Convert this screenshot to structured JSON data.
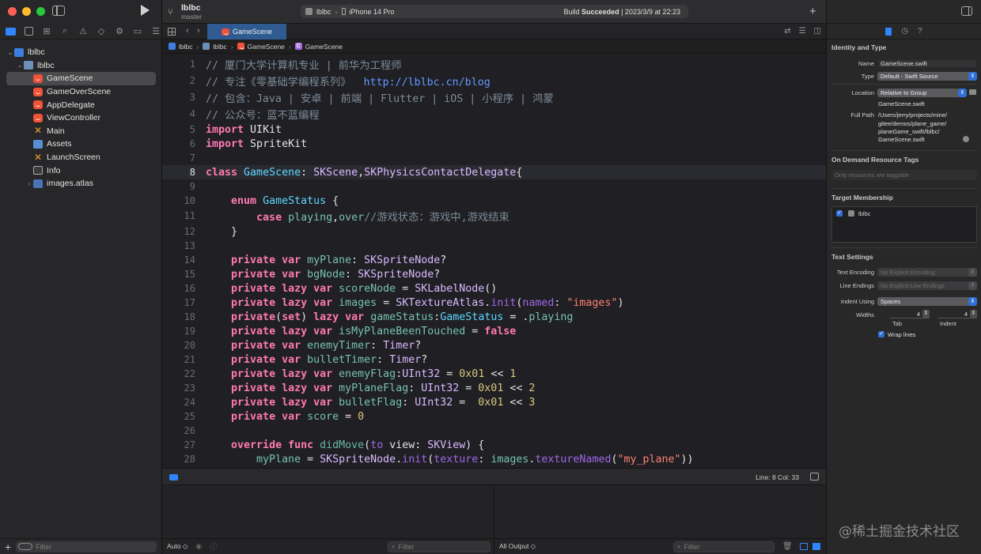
{
  "toolbar": {
    "project": "lblbc",
    "branch": "master",
    "scheme": "lblbc",
    "device": "iPhone 14 Pro",
    "build_prefix": "Build",
    "build_status": "Succeeded",
    "build_time": "| 2023/3/9 at 22:23",
    "add": "+"
  },
  "colors": {
    "accent": "#2f86ff",
    "close": "#ff5f57",
    "minimize": "#febc2e",
    "zoom": "#28c840",
    "keyword": "#ff7ab2",
    "comment": "#7f8c98",
    "string": "#ff8170",
    "number": "#d9c97c"
  },
  "navigator": {
    "tabs": [
      "folder-icon",
      "source-control-icon",
      "symbol-icon",
      "search-icon",
      "warning-icon",
      "test-icon",
      "debug-icon",
      "breakpoint-icon",
      "report-icon"
    ],
    "tree": [
      {
        "label": "lblbc",
        "icon": "project-icon",
        "indent": 0,
        "disclosure": "⌄"
      },
      {
        "label": "lblbc",
        "icon": "folder-icon",
        "indent": 1,
        "disclosure": "⌄"
      },
      {
        "label": "GameScene",
        "icon": "swift-icon",
        "indent": 2,
        "selected": true
      },
      {
        "label": "GameOverScene",
        "icon": "swift-icon",
        "indent": 2
      },
      {
        "label": "AppDelegate",
        "icon": "swift-icon",
        "indent": 2
      },
      {
        "label": "ViewController",
        "icon": "swift-icon",
        "indent": 2
      },
      {
        "label": "Main",
        "icon": "storyboard-icon",
        "indent": 2
      },
      {
        "label": "Assets",
        "icon": "assets-icon",
        "indent": 2
      },
      {
        "label": "LaunchScreen",
        "icon": "storyboard-icon",
        "indent": 2
      },
      {
        "label": "Info",
        "icon": "plist-icon",
        "indent": 2
      },
      {
        "label": "images.atlas",
        "icon": "atlas-icon",
        "indent": 2,
        "disclosure": "›"
      }
    ],
    "filter_placeholder": "Filter"
  },
  "tabbar": {
    "active_tab": "GameScene"
  },
  "breadcrumb": [
    "lblbc",
    "lblbc",
    "GameScene",
    "GameScene"
  ],
  "editor": {
    "current_line": 8,
    "lines": [
      {
        "n": "1",
        "tokens": [
          [
            "cmt",
            "// 厦门大学计算机专业 | 前华为工程师"
          ]
        ]
      },
      {
        "n": "2",
        "tokens": [
          [
            "cmt",
            "// 专注《零基础学编程系列》  "
          ],
          [
            "url",
            "http://lblbc.cn/blog"
          ]
        ]
      },
      {
        "n": "3",
        "tokens": [
          [
            "cmt",
            "// 包含：Java | 安卓 | 前端 | Flutter | iOS | 小程序 | 鸿蒙"
          ]
        ]
      },
      {
        "n": "4",
        "tokens": [
          [
            "cmt",
            "// 公众号：蓝不蓝编程"
          ]
        ]
      },
      {
        "n": "5",
        "tokens": [
          [
            "kw",
            "import"
          ],
          [
            "pl",
            " UIKit"
          ]
        ]
      },
      {
        "n": "6",
        "tokens": [
          [
            "kw",
            "import"
          ],
          [
            "pl",
            " SpriteKit"
          ]
        ]
      },
      {
        "n": "7",
        "tokens": []
      },
      {
        "n": "8",
        "tokens": [
          [
            "kw",
            "class"
          ],
          [
            "pl",
            " "
          ],
          [
            "tyd",
            "GameScene"
          ],
          [
            "pl",
            ": "
          ],
          [
            "ty",
            "SKScene"
          ],
          [
            "pl",
            ","
          ],
          [
            "ty",
            "SKPhysicsContactDelegate"
          ],
          [
            "pl",
            "{"
          ]
        ]
      },
      {
        "n": "9",
        "tokens": []
      },
      {
        "n": "10",
        "tokens": [
          [
            "pl",
            "    "
          ],
          [
            "kw",
            "enum"
          ],
          [
            "pl",
            " "
          ],
          [
            "tyd",
            "GameStatus"
          ],
          [
            "pl",
            " {"
          ]
        ]
      },
      {
        "n": "11",
        "tokens": [
          [
            "pl",
            "        "
          ],
          [
            "kw",
            "case"
          ],
          [
            "pl",
            " "
          ],
          [
            "idf",
            "playing"
          ],
          [
            "pl",
            ","
          ],
          [
            "idf",
            "over"
          ],
          [
            "cmt",
            "//游戏状态：游戏中,游戏结束"
          ]
        ]
      },
      {
        "n": "12",
        "tokens": [
          [
            "pl",
            "    }"
          ]
        ]
      },
      {
        "n": "13",
        "tokens": []
      },
      {
        "n": "14",
        "tokens": [
          [
            "pl",
            "    "
          ],
          [
            "kw",
            "private var"
          ],
          [
            "pl",
            " "
          ],
          [
            "idf",
            "myPlane"
          ],
          [
            "pl",
            ": "
          ],
          [
            "ty",
            "SKSpriteNode"
          ],
          [
            "pl",
            "?"
          ]
        ]
      },
      {
        "n": "15",
        "tokens": [
          [
            "pl",
            "    "
          ],
          [
            "kw",
            "private var"
          ],
          [
            "pl",
            " "
          ],
          [
            "idf",
            "bgNode"
          ],
          [
            "pl",
            ": "
          ],
          [
            "ty",
            "SKSpriteNode"
          ],
          [
            "pl",
            "?"
          ]
        ]
      },
      {
        "n": "16",
        "tokens": [
          [
            "pl",
            "    "
          ],
          [
            "kw",
            "private lazy var"
          ],
          [
            "pl",
            " "
          ],
          [
            "idf",
            "scoreNode"
          ],
          [
            "pl",
            " = "
          ],
          [
            "ty",
            "SKLabelNode"
          ],
          [
            "pl",
            "()"
          ]
        ]
      },
      {
        "n": "17",
        "tokens": [
          [
            "pl",
            "    "
          ],
          [
            "kw",
            "private lazy var"
          ],
          [
            "pl",
            " "
          ],
          [
            "idf",
            "images"
          ],
          [
            "pl",
            " = "
          ],
          [
            "ty",
            "SKTextureAtlas"
          ],
          [
            "pl",
            "."
          ],
          [
            "var",
            "init"
          ],
          [
            "pl",
            "("
          ],
          [
            "var",
            "named"
          ],
          [
            "pl",
            ": "
          ],
          [
            "str",
            "\"images\""
          ],
          [
            "pl",
            ")"
          ]
        ]
      },
      {
        "n": "18",
        "tokens": [
          [
            "pl",
            "    "
          ],
          [
            "kw",
            "private"
          ],
          [
            "pl",
            "("
          ],
          [
            "kw",
            "set"
          ],
          [
            "pl",
            ") "
          ],
          [
            "kw",
            "lazy var"
          ],
          [
            "pl",
            " "
          ],
          [
            "idf",
            "gameStatus"
          ],
          [
            "pl",
            ":"
          ],
          [
            "tyd",
            "GameStatus"
          ],
          [
            "pl",
            " = ."
          ],
          [
            "idf",
            "playing"
          ]
        ]
      },
      {
        "n": "19",
        "tokens": [
          [
            "pl",
            "    "
          ],
          [
            "kw",
            "private lazy var"
          ],
          [
            "pl",
            " "
          ],
          [
            "idf",
            "isMyPlaneBeenTouched"
          ],
          [
            "pl",
            " = "
          ],
          [
            "kw",
            "false"
          ]
        ]
      },
      {
        "n": "20",
        "tokens": [
          [
            "pl",
            "    "
          ],
          [
            "kw",
            "private var"
          ],
          [
            "pl",
            " "
          ],
          [
            "idf",
            "enemyTimer"
          ],
          [
            "pl",
            ": "
          ],
          [
            "ty",
            "Timer"
          ],
          [
            "pl",
            "?"
          ]
        ]
      },
      {
        "n": "21",
        "tokens": [
          [
            "pl",
            "    "
          ],
          [
            "kw",
            "private var"
          ],
          [
            "pl",
            " "
          ],
          [
            "idf",
            "bulletTimer"
          ],
          [
            "pl",
            ": "
          ],
          [
            "ty",
            "Timer"
          ],
          [
            "pl",
            "?"
          ]
        ]
      },
      {
        "n": "22",
        "tokens": [
          [
            "pl",
            "    "
          ],
          [
            "kw",
            "private lazy var"
          ],
          [
            "pl",
            " "
          ],
          [
            "idf",
            "enemyFlag"
          ],
          [
            "pl",
            ":"
          ],
          [
            "ty",
            "UInt32"
          ],
          [
            "pl",
            " = "
          ],
          [
            "num",
            "0x01"
          ],
          [
            "pl",
            " << "
          ],
          [
            "num",
            "1"
          ]
        ]
      },
      {
        "n": "23",
        "tokens": [
          [
            "pl",
            "    "
          ],
          [
            "kw",
            "private lazy var"
          ],
          [
            "pl",
            " "
          ],
          [
            "idf",
            "myPlaneFlag"
          ],
          [
            "pl",
            ": "
          ],
          [
            "ty",
            "UInt32"
          ],
          [
            "pl",
            " = "
          ],
          [
            "num",
            "0x01"
          ],
          [
            "pl",
            " << "
          ],
          [
            "num",
            "2"
          ]
        ]
      },
      {
        "n": "24",
        "tokens": [
          [
            "pl",
            "    "
          ],
          [
            "kw",
            "private lazy var"
          ],
          [
            "pl",
            " "
          ],
          [
            "idf",
            "bulletFlag"
          ],
          [
            "pl",
            ": "
          ],
          [
            "ty",
            "UInt32"
          ],
          [
            "pl",
            " =  "
          ],
          [
            "num",
            "0x01"
          ],
          [
            "pl",
            " << "
          ],
          [
            "num",
            "3"
          ]
        ]
      },
      {
        "n": "25",
        "tokens": [
          [
            "pl",
            "    "
          ],
          [
            "kw",
            "private var"
          ],
          [
            "pl",
            " "
          ],
          [
            "idf",
            "score"
          ],
          [
            "pl",
            " = "
          ],
          [
            "num",
            "0"
          ]
        ]
      },
      {
        "n": "26",
        "tokens": []
      },
      {
        "n": "27",
        "tokens": [
          [
            "pl",
            "    "
          ],
          [
            "kw",
            "override func"
          ],
          [
            "pl",
            " "
          ],
          [
            "fn",
            "didMove"
          ],
          [
            "pl",
            "("
          ],
          [
            "var",
            "to"
          ],
          [
            "pl",
            " view: "
          ],
          [
            "ty",
            "SKView"
          ],
          [
            "pl",
            ") {"
          ]
        ]
      },
      {
        "n": "28",
        "tokens": [
          [
            "pl",
            "        "
          ],
          [
            "idf",
            "myPlane"
          ],
          [
            "pl",
            " = "
          ],
          [
            "ty",
            "SKSpriteNode"
          ],
          [
            "pl",
            "."
          ],
          [
            "var",
            "init"
          ],
          [
            "pl",
            "("
          ],
          [
            "var",
            "texture"
          ],
          [
            "pl",
            ": "
          ],
          [
            "idf",
            "images"
          ],
          [
            "pl",
            "."
          ],
          [
            "var",
            "textureNamed"
          ],
          [
            "pl",
            "("
          ],
          [
            "str",
            "\"my_plane\""
          ],
          [
            "pl",
            "))"
          ]
        ]
      }
    ]
  },
  "status": {
    "cursor": "Line: 8  Col: 33"
  },
  "debug": {
    "scope": "Auto ◇",
    "filter_placeholder": "Filter",
    "output": "All Output ◇"
  },
  "inspector": {
    "identity_title": "Identity and Type",
    "name_label": "Name",
    "name_value": "GameScene.swift",
    "type_label": "Type",
    "type_value": "Default - Swift Source",
    "location_label": "Location",
    "location_value": "Relative to Group",
    "location_file": "GameScene.swift",
    "fullpath_label": "Full Path",
    "fullpath_lines": [
      "/Users/jerry/projects/mine/",
      "gitee/demos/plane_game/",
      "planeGame_swift/lblbc/",
      "GameScene.swift"
    ],
    "tags_title": "On Demand Resource Tags",
    "tags_placeholder": "Only resources are taggable",
    "membership_title": "Target Membership",
    "membership_target": "lblbc",
    "text_title": "Text Settings",
    "encoding_label": "Text Encoding",
    "encoding_value": "No Explicit Encoding",
    "endings_label": "Line Endings",
    "endings_value": "No Explicit Line Endings",
    "indent_label": "Indent Using",
    "indent_value": "Spaces",
    "widths_label": "Widths",
    "tab_width": "4",
    "indent_width": "4",
    "tab_caption": "Tab",
    "indent_caption": "Indent",
    "wrap_label": "Wrap lines"
  },
  "watermark": "@稀土掘金技术社区"
}
